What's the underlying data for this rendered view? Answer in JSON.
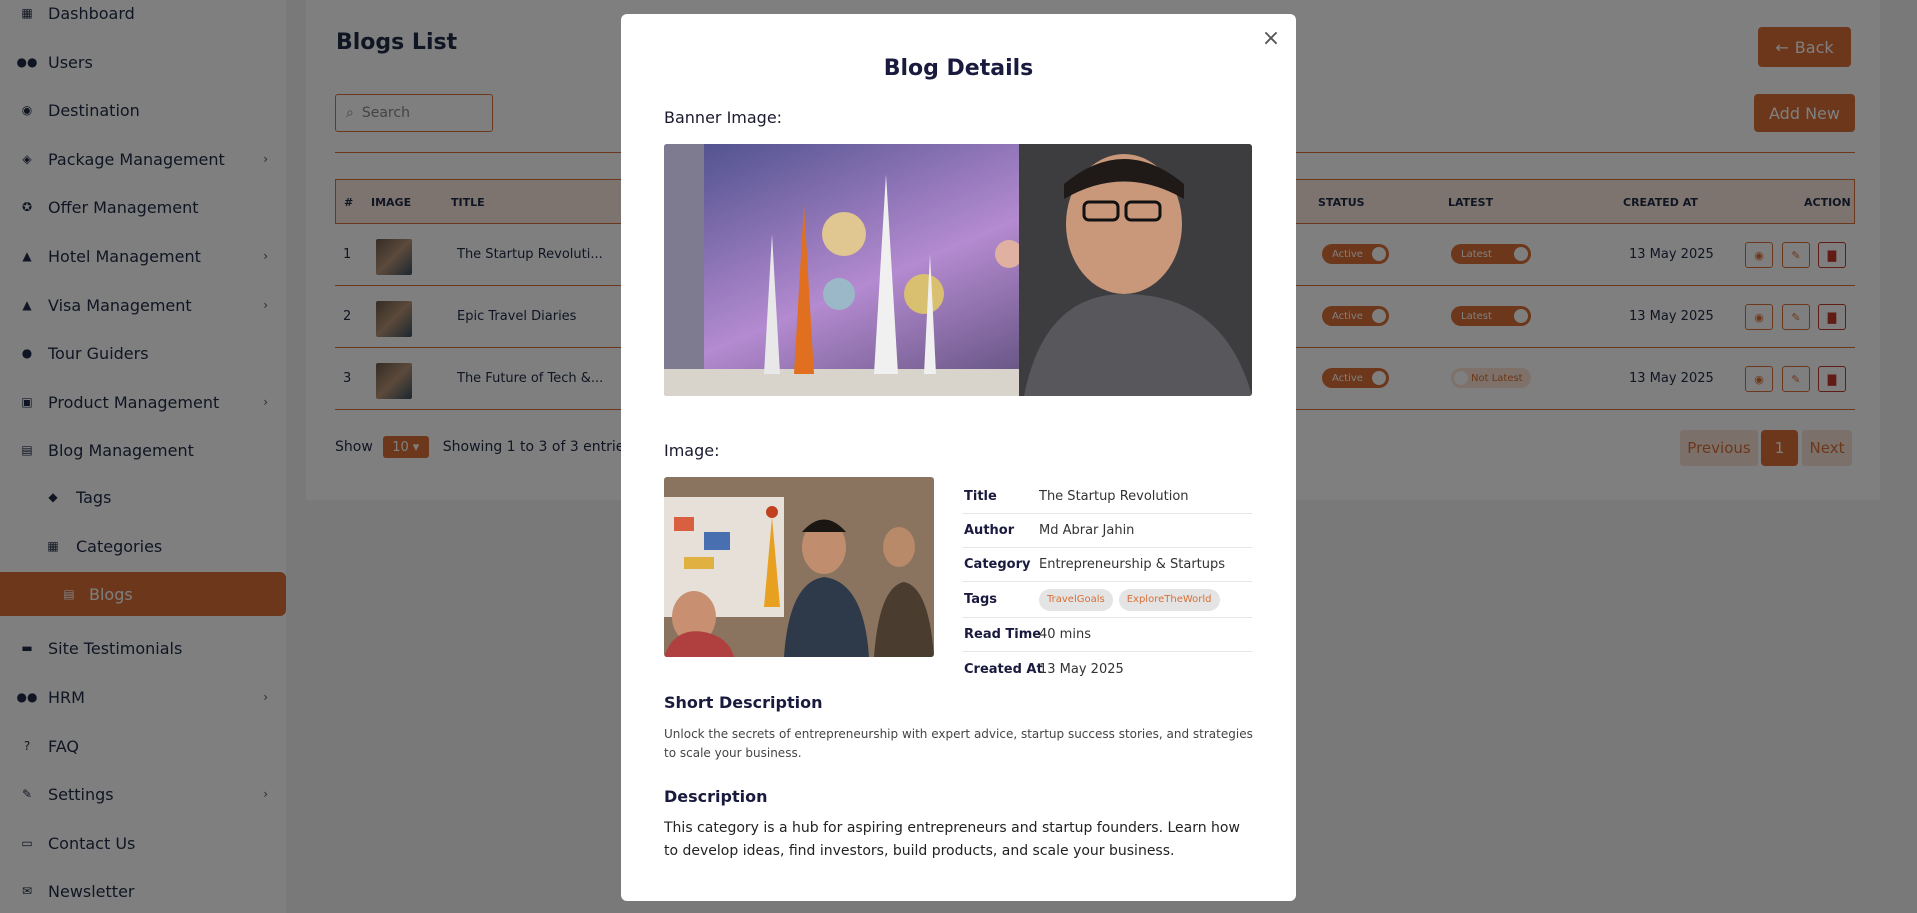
{
  "sidebar": {
    "items": [
      {
        "label": "Dashboard",
        "icon": "grid-icon"
      },
      {
        "label": "Users",
        "icon": "users-icon"
      },
      {
        "label": "Destination",
        "icon": "location-icon"
      },
      {
        "label": "Package Management",
        "icon": "box-icon"
      },
      {
        "label": "Offer Management",
        "icon": "percent-icon"
      },
      {
        "label": "Hotel Management",
        "icon": "hotel-icon"
      },
      {
        "label": "Visa Management",
        "icon": "visa-icon"
      },
      {
        "label": "Tour Guiders",
        "icon": "user-icon"
      },
      {
        "label": "Product Management",
        "icon": "products-icon"
      },
      {
        "label": "Blog Management",
        "icon": "blog-icon"
      },
      {
        "label": "Tags",
        "icon": "tags-icon"
      },
      {
        "label": "Categories",
        "icon": "categories-icon"
      },
      {
        "label": "Blogs",
        "icon": "blog-file-icon"
      },
      {
        "label": "Site Testimonials",
        "icon": "testimonial-icon"
      },
      {
        "label": "HRM",
        "icon": "hrm-icon"
      },
      {
        "label": "FAQ",
        "icon": "question-icon"
      },
      {
        "label": "Settings",
        "icon": "wrench-icon"
      },
      {
        "label": "Contact Us",
        "icon": "contact-icon"
      },
      {
        "label": "Newsletter",
        "icon": "mail-icon"
      }
    ]
  },
  "main": {
    "title": "Blogs List",
    "back_label": "Back",
    "add_label": "Add New",
    "search_placeholder": "Search",
    "columns": {
      "num": "#",
      "image": "IMAGE",
      "title": "TITLE",
      "status": "STATUS",
      "latest": "LATEST",
      "created_at": "CREATED AT",
      "action": "ACTION"
    },
    "rows": [
      {
        "num": "1",
        "title": "The Startup Revoluti...",
        "status": "Active",
        "latest": "Latest",
        "date": "13 May 2025"
      },
      {
        "num": "2",
        "title": "Epic Travel Diaries",
        "status": "Active",
        "latest": "Latest",
        "date": "13 May 2025"
      },
      {
        "num": "3",
        "title": "The Future of Tech &...",
        "status": "Active",
        "latest": "Not Latest",
        "date": "13 May 2025"
      }
    ],
    "show_label": "Show",
    "page_length": "10",
    "entries_info": "Showing 1 to 3 of 3 entries",
    "pagination": {
      "prev": "Previous",
      "current": "1",
      "next": "Next"
    }
  },
  "modal": {
    "title": "Blog Details",
    "banner_label": "Banner Image:",
    "image_label": "Image:",
    "details": {
      "title_key": "Title",
      "title_val": "The Startup Revolution",
      "author_key": "Author",
      "author_val": "Md Abrar Jahin",
      "category_key": "Category",
      "category_val": "Entrepreneurship & Startups",
      "tags_key": "Tags",
      "tags": [
        "TravelGoals",
        "ExploreTheWorld"
      ],
      "read_time_key": "Read Time",
      "read_time_val": "40 mins",
      "created_key": "Created At",
      "created_val": "13 May 2025"
    },
    "short_desc_title": "Short Description",
    "short_desc": "Unlock the secrets of entrepreneurship with expert advice, startup success stories, and strategies to scale your business.",
    "desc_title": "Description",
    "desc": "This category is a hub for aspiring entrepreneurs and startup founders. Learn how to develop ideas, find investors, build products, and scale your business."
  },
  "colors": {
    "accent": "#d96f35",
    "text": "#1a1a2e",
    "overlay": "rgba(0,0,0,0.5)"
  }
}
